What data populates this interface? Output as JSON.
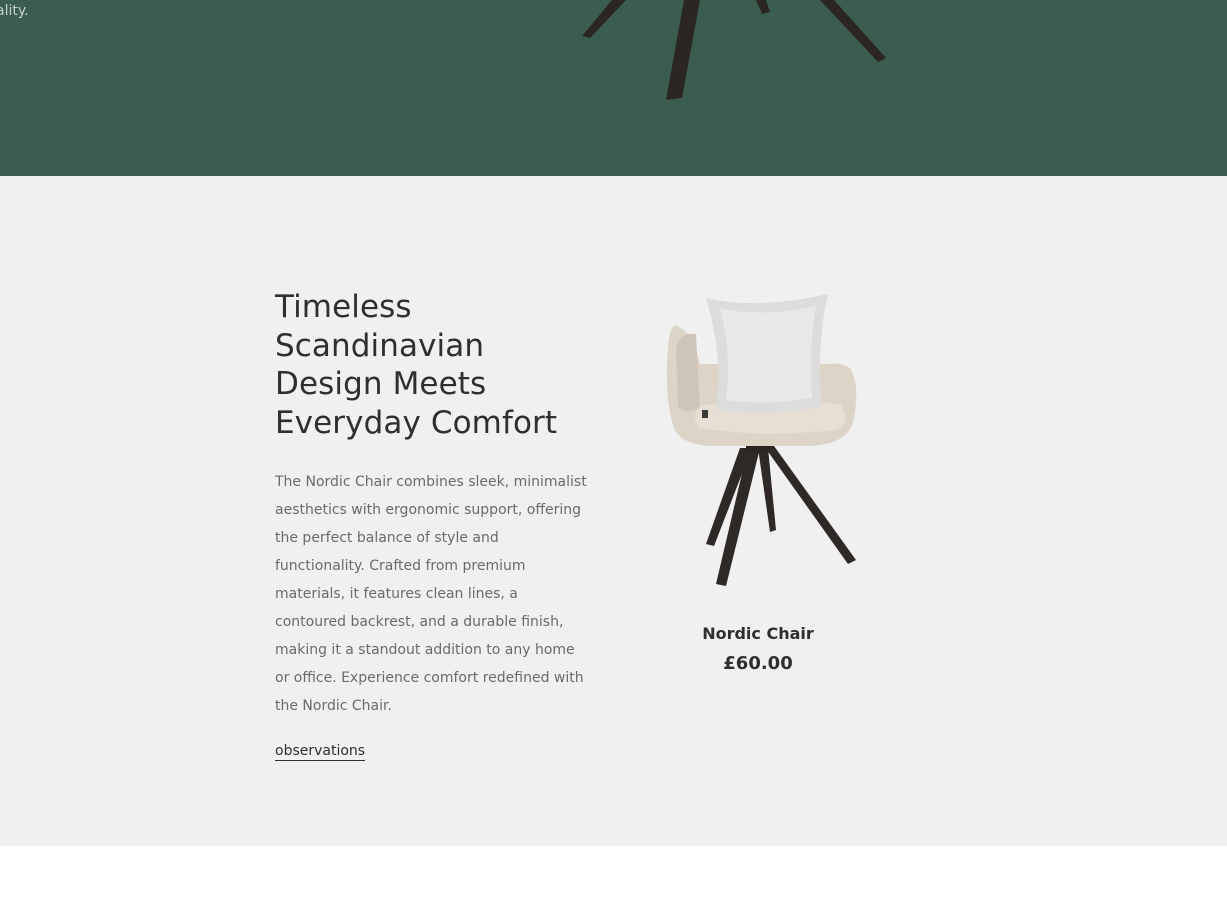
{
  "hero": {
    "text_fragment": "ality."
  },
  "feature": {
    "heading": "Timeless Scandinavian Design Meets Everyday Comfort",
    "description": "The Nordic Chair combines sleek, minimalist aesthetics with ergonomic support, offering the perfect balance of style and functionality. Crafted from premium materials, it features clean lines, a contoured backrest, and a durable finish, making it a standout addition to any home or office. Experience comfort redefined with the Nordic Chair.",
    "link_label": "observations"
  },
  "product": {
    "name": "Nordic Chair",
    "price": "£60.00",
    "image_icon": "chair-image"
  },
  "colors": {
    "hero_bg": "#3b5d50",
    "section_bg": "#eff0ef",
    "text_dark": "#2f2f2f",
    "text_muted": "#6a6a6a"
  }
}
